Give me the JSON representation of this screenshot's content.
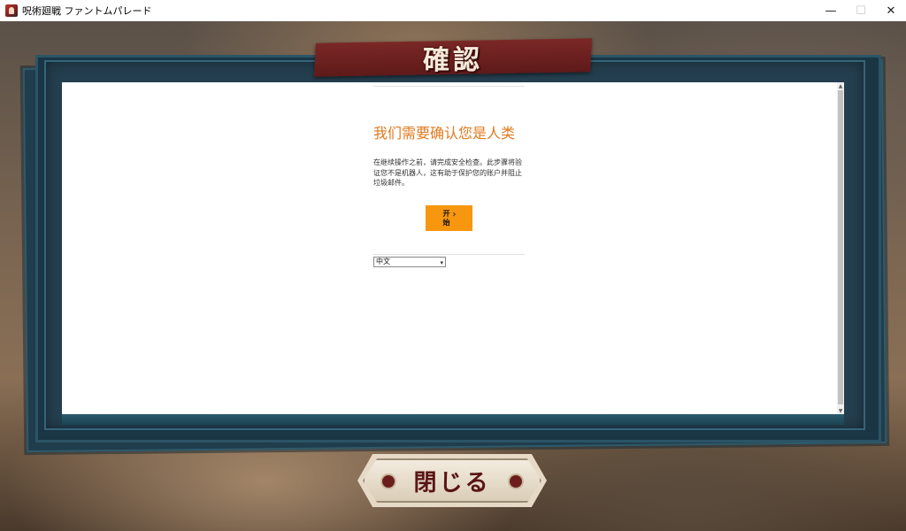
{
  "window": {
    "title": "呪術廻戦 ファントムパレード",
    "controls": {
      "minimize": "—",
      "maximize": "☐",
      "close": "✕"
    }
  },
  "dialog": {
    "title": "確認",
    "close_label": "閉じる"
  },
  "webview": {
    "heading": "我们需要确认您是人类",
    "description": "在继续操作之前，请完成安全检查。此步骤将验证您不是机器人，这有助于保护您的账户并阻止垃圾邮件。",
    "start_button": "开始",
    "start_chevron": "›",
    "language_select": {
      "value": "中文",
      "caret": "▾"
    },
    "scroll_up": "▲",
    "scroll_down": "▼"
  },
  "colors": {
    "heading": "#e17a1d",
    "start_button": "#f7960f",
    "banner": "#7a2826",
    "frame": "#1f3d4c"
  },
  "icons": {
    "app": "app-icon",
    "chevron": "chevron-right-icon"
  }
}
